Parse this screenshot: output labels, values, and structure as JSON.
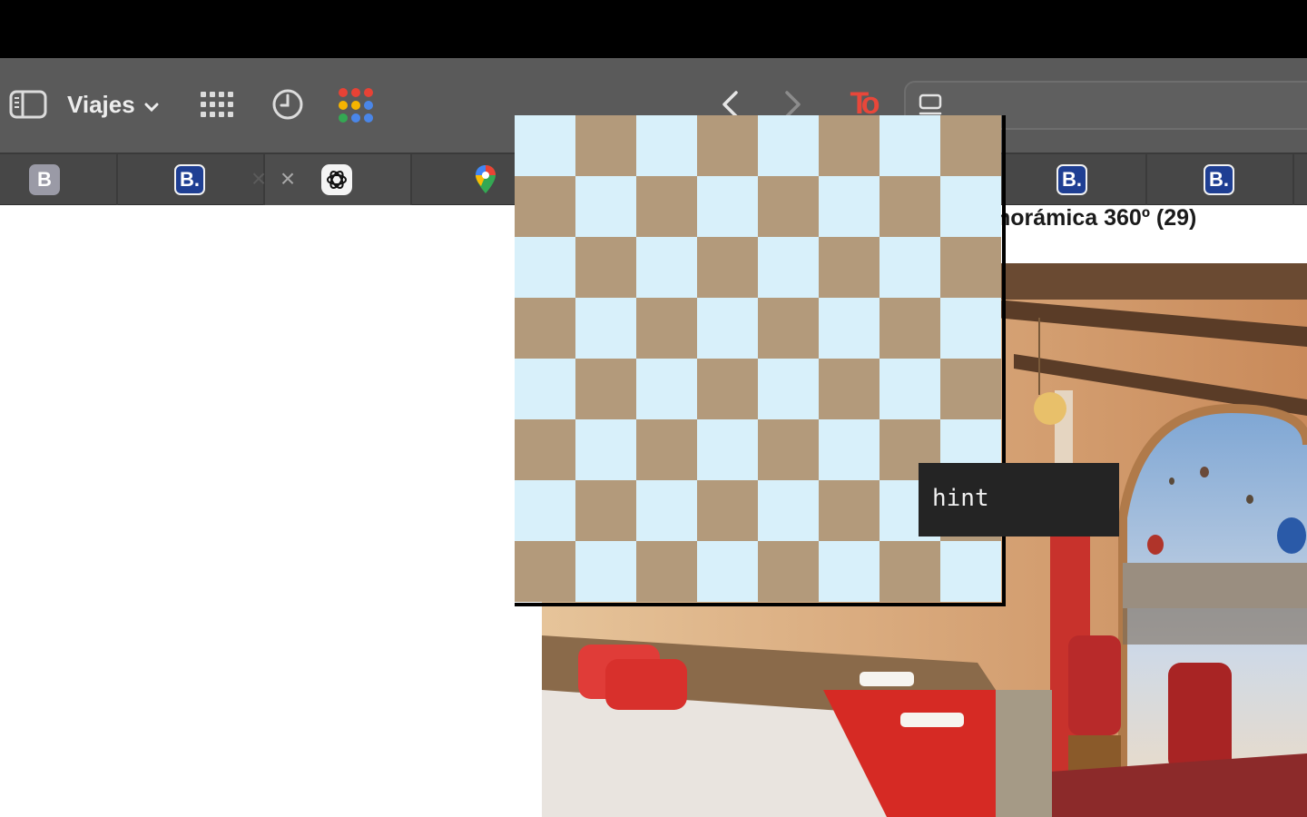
{
  "toolbar": {
    "tab_group_label": "Viajes",
    "extension_label": "To",
    "icons": [
      "sidebar-icon",
      "chevron-down-icon",
      "grid-icon",
      "history-icon",
      "apps-icon",
      "back-icon",
      "forward-icon",
      "extension-icon",
      "address-tabs-icon"
    ]
  },
  "tabs": [
    {
      "favicon": "B",
      "favicon_name": "booking-gray-icon",
      "active": false
    },
    {
      "favicon": "B.",
      "favicon_name": "booking-icon",
      "active": false
    },
    {
      "favicon": "",
      "favicon_name": "chatgpt-icon",
      "active": true
    },
    {
      "favicon": "",
      "favicon_name": "google-maps-icon",
      "active": false
    },
    {
      "favicon": "B.",
      "favicon_name": "booking-icon",
      "active": false
    },
    {
      "favicon": "B.",
      "favicon_name": "booking-icon",
      "active": false
    }
  ],
  "content": {
    "heading_fragment": "norámica 360º (29)",
    "photo_alt": "hotel room with bed and balcony view of hot air balloons"
  },
  "chessboard": {
    "rows": 8,
    "cols": 8,
    "light_color": "#d8f0fa",
    "dark_color": "#b39a7b"
  },
  "hint_button": {
    "label": "hint"
  },
  "colors": {
    "toolbar": "#5a5a5a",
    "tabbar": "#474747",
    "booking_blue": "#1f3f93",
    "extension_red": "#e8473a"
  }
}
